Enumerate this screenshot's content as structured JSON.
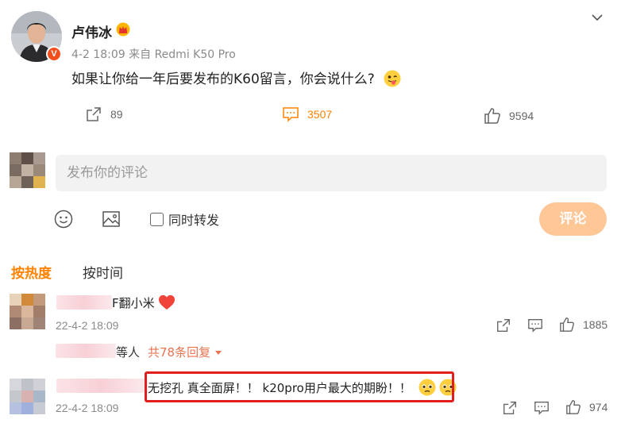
{
  "post": {
    "author": "卢伟冰",
    "verified_badge": "V",
    "date": "4-2 18:09",
    "source_prefix": "来自",
    "device": "Redmi K50 Pro",
    "text": "如果让你给一年后要发布的K60留言，你会说什么?",
    "emoji_icon": "tongue-out-emoji"
  },
  "actions": {
    "share_count": "89",
    "comment_count": "3507",
    "like_count": "9594"
  },
  "compose": {
    "placeholder": "发布你的评论",
    "repost_label": "同时转发",
    "submit_label": "评论"
  },
  "sort": {
    "hot_label": "按热度",
    "time_label": "按时间"
  },
  "comments": [
    {
      "text_visible": "F翻小米",
      "date": "22-4-2 18:09",
      "like_count": "1885",
      "replies_prefix": "等人",
      "replies_link": "共78条回复"
    },
    {
      "text_visible": "无挖孔 真全面屏！！ k20pro用户最大的期盼！！",
      "date": "22-4-2 18:09",
      "like_count": "974"
    }
  ],
  "colors": {
    "accent": "#ff8200",
    "submit_bg": "#ffc696",
    "highlight_box": "#e01e1e"
  }
}
